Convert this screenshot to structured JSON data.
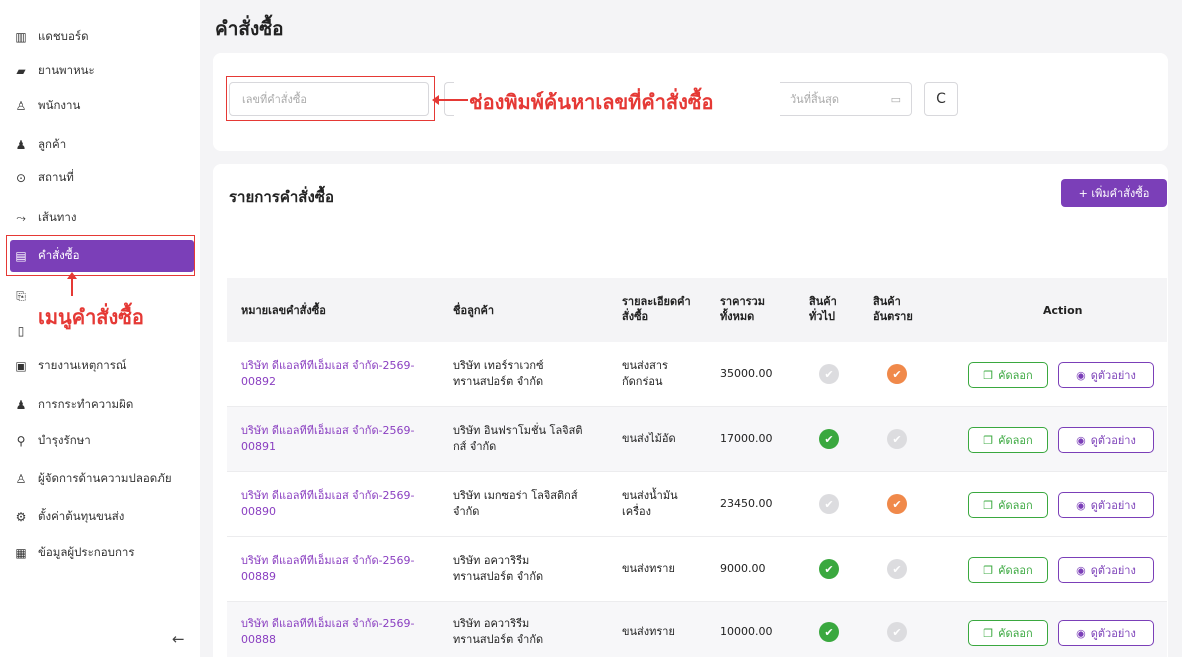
{
  "page": {
    "title": "คำสั่งซื้อ"
  },
  "sidebar": {
    "items": [
      {
        "label": "แดชบอร์ด",
        "icon": "chart-icon",
        "glyph": "📊"
      },
      {
        "label": "ยานพาหนะ",
        "icon": "truck-icon",
        "glyph": "🚚"
      },
      {
        "label": "พนักงาน",
        "icon": "user-icon",
        "glyph": "👤"
      },
      {
        "label": "ลูกค้า",
        "icon": "users-icon",
        "glyph": "👥"
      },
      {
        "label": "สถานที่",
        "icon": "location-pin-icon",
        "glyph": "⊙"
      },
      {
        "label": "เส้นทาง",
        "icon": "route-icon",
        "glyph": "⤳"
      },
      {
        "label": "คำสั่งซื้อ",
        "icon": "clipboard-icon",
        "glyph": "📋"
      },
      {
        "label": "",
        "icon": "document-icon",
        "glyph": "⎘"
      },
      {
        "label": "",
        "icon": "report-icon",
        "glyph": "▤"
      },
      {
        "label": "รายงานเหตุการณ์",
        "icon": "incident-report-icon",
        "glyph": "▣"
      },
      {
        "label": "การกระทำความผิด",
        "icon": "violation-user-icon",
        "glyph": "♟"
      },
      {
        "label": "บำรุงรักษา",
        "icon": "wrench-icon",
        "glyph": "🔧"
      },
      {
        "label": "ผู้จัดการด้านความปลอดภัย",
        "icon": "safety-manager-icon",
        "glyph": "♙"
      },
      {
        "label": "ตั้งค่าต้นทุนขนส่ง",
        "icon": "gear-icon",
        "glyph": "⚙"
      },
      {
        "label": "ข้อมูลผู้ประกอบการ",
        "icon": "building-icon",
        "glyph": "▦"
      }
    ],
    "collapse_glyph": "←"
  },
  "annotations": {
    "menu_label": "เมนูคำสั่งซื้อ",
    "search_label": "ช่องพิมพ์ค้นหาเลขที่คำสั่งซื้อ"
  },
  "filters": {
    "search_placeholder": "เลขที่คำสั่งซื้อ",
    "end_date_placeholder": "วันที่สิ้นสุด",
    "calendar_glyph": "🗓",
    "refresh_glyph": "C"
  },
  "list": {
    "title": "รายการคำสั่งซื้อ",
    "add_button": "+ เพิ่มคำสั่งซื้อ",
    "columns": [
      "หมายเลขคำสั่งซื้อ",
      "ชื่อลูกค้า",
      "รายละเอียดคำสั่งซื้อ",
      "ราคารวมทั้งหมด",
      "สินค้าทั่วไป",
      "สินค้าอันตราย",
      "Action"
    ],
    "copy_label": "คัดลอก",
    "view_label": "ดูตัวอย่าง",
    "rows": [
      {
        "order_no": "บริษัท ดีแอลทีทีเอ็มเอส จำกัด-2569-00892",
        "customer": "บริษัท เทอร์ราเวกซ์ ทรานสปอร์ต จำกัด",
        "detail": "ขนส่งสารกัดกร่อน",
        "total": "35000.00",
        "general": "gray",
        "hazard": "orange"
      },
      {
        "order_no": "บริษัท ดีแอลทีทีเอ็มเอส จำกัด-2569-00891",
        "customer": "บริษัท อินฟราโมชั่น โลจิสติกส์ จำกัด",
        "detail": "ขนส่งไม้อัด",
        "total": "17000.00",
        "general": "green",
        "hazard": "gray"
      },
      {
        "order_no": "บริษัท ดีแอลทีทีเอ็มเอส จำกัด-2569-00890",
        "customer": "บริษัท เมกซอร่า โลจิสติกส์ จำกัด",
        "detail": "ขนส่งน้ำมันเครื่อง",
        "total": "23450.00",
        "general": "gray",
        "hazard": "orange"
      },
      {
        "order_no": "บริษัท ดีแอลทีทีเอ็มเอส จำกัด-2569-00889",
        "customer": "บริษัท อควาริรีม ทรานสปอร์ต จำกัด",
        "detail": "ขนส่งทราย",
        "total": "9000.00",
        "general": "green",
        "hazard": "gray"
      },
      {
        "order_no": "บริษัท ดีแอลทีทีเอ็มเอส จำกัด-2569-00888",
        "customer": "บริษัท อควาริรีม ทรานสปอร์ต จำกัด",
        "detail": "ขนส่งทราย",
        "total": "10000.00",
        "general": "green",
        "hazard": "gray"
      }
    ]
  },
  "colors": {
    "accent": "#7b3fb8",
    "success": "#3aa83f",
    "warning": "#f0894a",
    "annotation": "#e53935"
  }
}
